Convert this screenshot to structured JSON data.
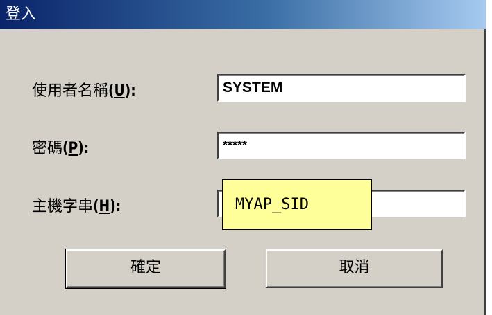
{
  "window": {
    "title": "登入"
  },
  "form": {
    "username": {
      "label": "使用者名稱",
      "mnemonic": "U",
      "value": "SYSTEM"
    },
    "password": {
      "label": "密碼",
      "mnemonic": "P",
      "value": "*****"
    },
    "host": {
      "label": "主機字串",
      "mnemonic": "H",
      "value": ""
    }
  },
  "tooltip": {
    "text": "MYAP_SID"
  },
  "buttons": {
    "ok_label": "確定",
    "cancel_label": "取消"
  },
  "colors": {
    "dialog_bg": "#d4d0c8",
    "titlebar_start": "#0a246a",
    "titlebar_end": "#a6caf0",
    "tooltip_bg": "#ffff99"
  }
}
